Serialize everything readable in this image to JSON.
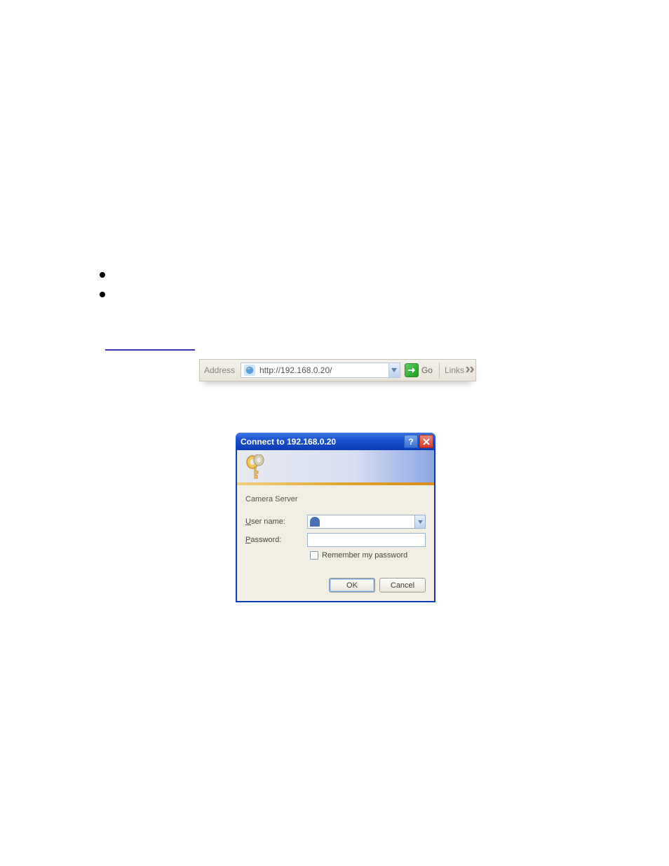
{
  "address_bar": {
    "label": "Address",
    "url": "http://192.168.0.20/",
    "go": "Go",
    "links": "Links"
  },
  "dialog": {
    "title": "Connect to 192.168.0.20",
    "realm": "Camera Server",
    "user_label_u": "U",
    "user_label_rest": "ser name:",
    "pass_label_p": "P",
    "pass_label_rest": "assword:",
    "remember_r": "R",
    "remember_rest": "emember my password",
    "ok": "OK",
    "cancel": "Cancel"
  }
}
